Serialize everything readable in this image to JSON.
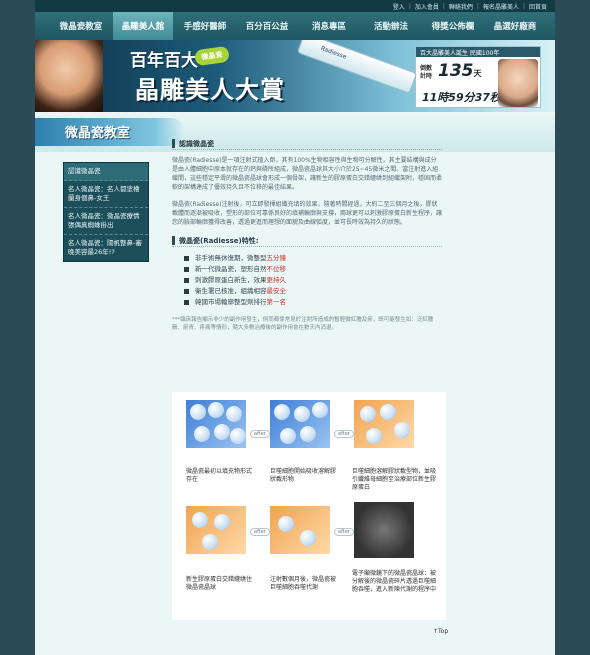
{
  "utility_links": [
    "登入",
    "加入會員",
    "聯絡我們",
    "報名晶雕美人",
    "回首頁"
  ],
  "nav": {
    "items": [
      "微晶瓷教室",
      "晶雕美人館",
      "手感好醫師",
      "百分百公益",
      "消息專區",
      "活動辦法",
      "得獎公佈欄",
      "晶選好廠商"
    ],
    "active_index": 1
  },
  "banner": {
    "title_line1": "百年百大",
    "title_line2": "晶雕美人大賞",
    "badge": "微晶瓷",
    "syringe_label": "Radiesse",
    "counter": {
      "header": "百大晶雕美人誕生 民國100年",
      "label": "倒數計時",
      "days": "135",
      "days_unit": "天",
      "time": "11時59分37秒"
    }
  },
  "section_title": "微晶瓷教室",
  "sidebar": {
    "items": [
      "認識微晶瓷",
      "名人微晶瓷：名人都塗檜蘭身個鼻-女王",
      "名人微晶瓷：微晶瓷療情張偶真蜘蛛掛出",
      "名人微晶瓷：陽帆整鼻-審晚美容最26年!?"
    ]
  },
  "main": {
    "heading1": "認識微晶瓷",
    "para1": "微晶瓷(Radiesse)是一項注射式植入劑，其有100%生物相容性與生物可分解性，其主要結構與成分是由人體細胞中原本就存在的鈣與磷所組成，微晶瓷晶球其大小介於25~45微米之間。當注射進入組織間，這些穩定平滑的微晶瓷晶球會形成一個骨架，讓新生的膠原蛋白交錯纏繞到組織架附，穩固而柔軟的架構達成了優效持久且不位移的最佳結果。",
    "para2": "微晶瓷(Radiesse)注射後，可立即發揮組織充填的效果，隨著時間經過，大約二至三個月之後，膠狀載體而逐漸被吸收，塑形的部位可靠係良好的填補輪廓與支撐，兩球更可以刺激膠原蛋白新生程序，讓您的臉部輪廓獲得改善，透過更進而理想的面貌及曲線弧度，並可長時效為持久的狀態。",
    "heading2": "微晶瓷(Radiesse)特性:",
    "features": [
      {
        "text": "非手術無休復期，微整型",
        "highlight": "五分鐘"
      },
      {
        "text": "新一代微晶瓷，塑形自然",
        "highlight": "不位移"
      },
      {
        "text": "刺激膠原蛋白新生，效果",
        "highlight": "更持久"
      },
      {
        "text": "衛生署已核准，組織相容",
        "highlight": "最安全"
      },
      {
        "text": "韓國市場輪廓整型劑排行",
        "highlight": "第一名"
      }
    ],
    "note": "***臨床報告顯示非少的副作用發生，例而都係常見於注射所造成的暫輕微紅腫及瘀，既可能發生如：泛紅腫脹、瘀青、疼痛等情形，隨大多數治療後的副作用會在數天內消退。"
  },
  "diagram": {
    "after_label": "after",
    "captions": [
      "微晶瓷最初以填充物形式存在",
      "巨噬細胞開始吸收溶解膠狀載形物",
      "巨噬細胞溶解膠狀載型物，並吸引纖維母細胞至治療部位新生膠原蛋白",
      "新生膠原蛋白交錯纏繞住微晶瓷晶球",
      "注射數個月後，微晶瓷被巨噬細胞吞噬代謝",
      "電子顯微鏡下的微晶瓷晶球：被分解後的微晶瓷碎片透過巨噬細胞吞噬，進入新陳代謝的程序中"
    ]
  },
  "top_link": "↑Top"
}
